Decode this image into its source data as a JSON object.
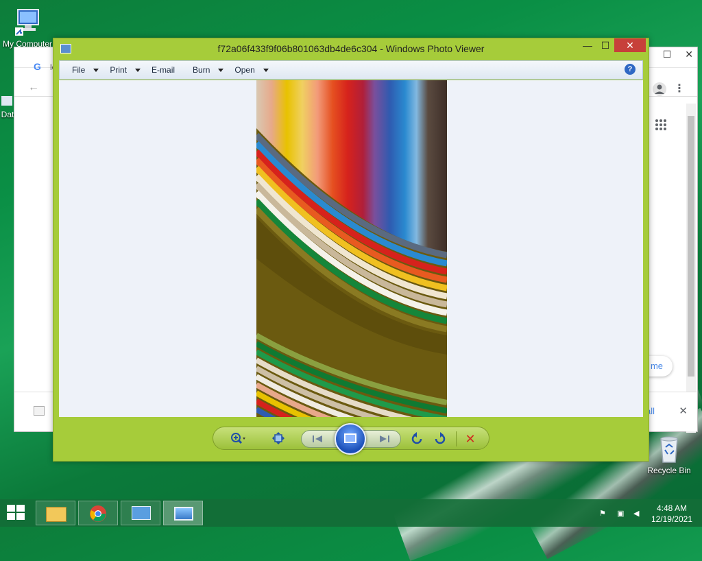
{
  "desktop": {
    "icons": [
      {
        "label": "My Computer"
      },
      {
        "label": "Dat"
      },
      {
        "label": "Recycle Bin"
      }
    ]
  },
  "background_window": {
    "tab_letter": "le",
    "controls": {
      "minimize": "—",
      "maximize": "☐",
      "close": "✕"
    },
    "partial_button_text": "me",
    "downloads_text": "all",
    "downloads_close": "✕"
  },
  "photo_viewer": {
    "title": "f72a06f433f9f06b801063db4de6c304 - Windows Photo Viewer",
    "controls": {
      "minimize": "—",
      "maximize": "☐",
      "close": "✕"
    },
    "menu": {
      "file": "File",
      "print": "Print",
      "email": "E-mail",
      "burn": "Burn",
      "open": "Open"
    },
    "help": "?",
    "toolbar": {
      "zoom": "zoom-icon",
      "fit": "fit-window-icon",
      "previous": "previous-icon",
      "slideshow": "slideshow-icon",
      "next": "next-icon",
      "rotate_ccw": "rotate-counterclockwise-icon",
      "rotate_cw": "rotate-clockwise-icon",
      "delete": "delete-icon"
    }
  },
  "taskbar": {
    "apps": [
      "file-explorer",
      "chrome",
      "control-panel",
      "photo-viewer"
    ],
    "time": "4:48 AM",
    "date": "12/19/2021"
  },
  "colors": {
    "viewer_frame": "#a6cc3a",
    "close_red": "#c7403a",
    "desktop_green": "#0a8f45"
  }
}
